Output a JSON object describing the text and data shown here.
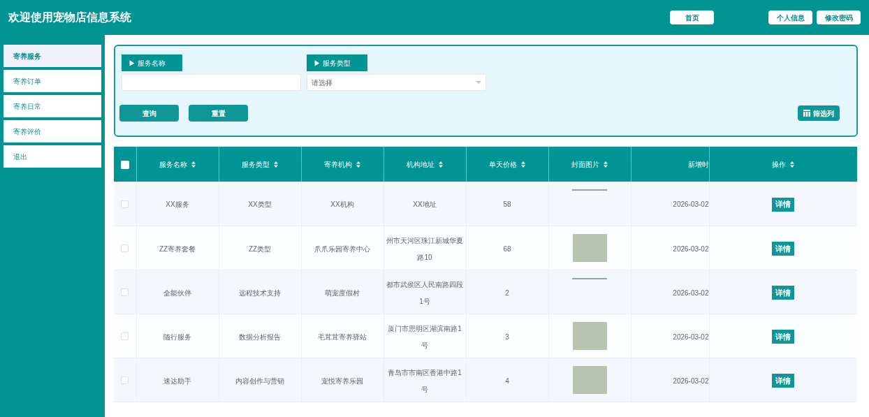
{
  "header": {
    "title": "欢迎使用宠物店信息系统",
    "buttons": [
      "首页",
      "个人信息",
      "修改密码"
    ]
  },
  "sidebar": {
    "items": [
      {
        "label": "寄养服务",
        "selected": true
      },
      {
        "label": "寄养订单",
        "selected": false
      },
      {
        "label": "寄养日常",
        "selected": false
      },
      {
        "label": "寄养评价",
        "selected": false
      },
      {
        "label": "退出",
        "selected": false
      }
    ]
  },
  "search": {
    "fields": [
      {
        "label": "▶ 服务名称",
        "kind": "text"
      },
      {
        "label": "▶ 服务类型",
        "kind": "select",
        "placeholder": "请选择"
      }
    ],
    "buttons": [
      "查询",
      "重置"
    ],
    "column_filter": "筛选列"
  },
  "table": {
    "select_all": {
      "checked": false
    },
    "columns": [
      {
        "label": "服务名称",
        "sortable": true
      },
      {
        "label": "服务类型",
        "sortable": true
      },
      {
        "label": "寄养机构",
        "sortable": true
      },
      {
        "label": "机构地址",
        "sortable": true
      },
      {
        "label": "单天价格",
        "sortable": true
      },
      {
        "label": "封面图片",
        "sortable": true
      },
      {
        "label": "新增时",
        "sortable": false
      },
      {
        "label": "操作",
        "sortable": true
      }
    ],
    "rows": [
      {
        "checked": false,
        "cells": [
          "XX服务",
          "XX类型",
          "XX机构",
          "XX地址",
          "58"
        ],
        "cover": {
          "kind": "partial"
        },
        "time": "2026-03-02",
        "action": "详情"
      },
      {
        "checked": false,
        "cells": [
          "ZZ寄养套餐",
          "ZZ类型",
          "爪爪乐园寄养中心",
          "州市天河区珠江新城华夏路10",
          "68"
        ],
        "cover": {
          "kind": "photo"
        },
        "time": "2026-03-02",
        "action": "详情"
      },
      {
        "checked": false,
        "cells": [
          "全能伙伴",
          "远程技术支持",
          "萌宠度假村",
          "都市武侯区人民南路四段1号",
          "2"
        ],
        "cover": {
          "kind": "partial"
        },
        "time": "2026-03-02",
        "action": "详情"
      },
      {
        "checked": false,
        "cells": [
          "随行服务",
          "数据分析报告",
          "毛茸茸寄养驿站",
          "厦门市思明区湖滨南路1号",
          "3"
        ],
        "cover": {
          "kind": "photo"
        },
        "time": "2026-03-02",
        "action": "详情"
      },
      {
        "checked": false,
        "cells": [
          "速达助手",
          "内容创作与营销",
          "宠悦寄养乐园",
          "青岛市市南区香港中路1号",
          "4"
        ],
        "cover": {
          "kind": "photo"
        },
        "time": "2026-03-02",
        "action": "详情"
      }
    ]
  }
}
